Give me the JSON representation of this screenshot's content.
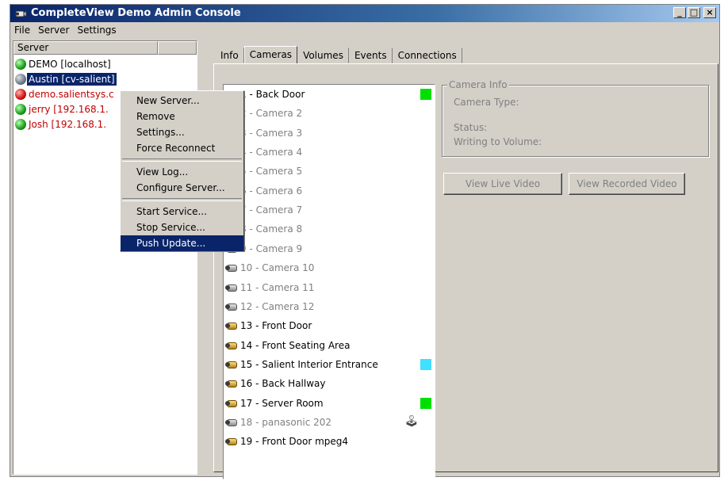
{
  "window": {
    "title": "CompleteView Demo Admin Console",
    "controls": [
      "_",
      "□",
      "×"
    ]
  },
  "menubar": [
    "File",
    "Server",
    "Settings"
  ],
  "server_pane": {
    "header": "Server",
    "servers": [
      {
        "label": "DEMO [localhost]",
        "status": "green",
        "color": "#000000"
      },
      {
        "label": "Austin [cv-salient]",
        "status": "gray",
        "color": "#000000",
        "selected": true
      },
      {
        "label": "demo.salientsys.c",
        "status": "red",
        "color": "#c00000"
      },
      {
        "label": "jerry [192.168.1.",
        "status": "green",
        "color": "#c00000"
      },
      {
        "label": "Josh [192.168.1.",
        "status": "green",
        "color": "#c00000"
      }
    ]
  },
  "context_menu": {
    "groups": [
      [
        "New Server...",
        "Remove",
        "Settings...",
        "Force Reconnect"
      ],
      [
        "View Log...",
        "Configure Server..."
      ],
      [
        "Start Service...",
        "Stop Service...",
        "Push Update..."
      ]
    ],
    "highlighted": "Push Update..."
  },
  "tabs": [
    "Info",
    "Cameras",
    "Volumes",
    "Events",
    "Connections"
  ],
  "active_tab": "Cameras",
  "cameras": [
    {
      "label": "1 - Back Door",
      "active": true,
      "status_color": "#00e000"
    },
    {
      "label": "2 - Camera 2",
      "active": false
    },
    {
      "label": "3 - Camera 3",
      "active": false
    },
    {
      "label": "4 - Camera 4",
      "active": false
    },
    {
      "label": "5 - Camera 5",
      "active": false
    },
    {
      "label": "6 - Camera 6",
      "active": false
    },
    {
      "label": "7 - Camera 7",
      "active": false
    },
    {
      "label": "8 - Camera 8",
      "active": false
    },
    {
      "label": "9 - Camera 9",
      "active": false
    },
    {
      "label": "10 - Camera 10",
      "active": false
    },
    {
      "label": "11 - Camera 11",
      "active": false
    },
    {
      "label": "12 - Camera 12",
      "active": false
    },
    {
      "label": "13 - Front Door",
      "active": true
    },
    {
      "label": "14 - Front Seating Area",
      "active": true
    },
    {
      "label": "15 - Salient Interior Entrance",
      "active": true,
      "status_color": "#40e0ff"
    },
    {
      "label": "16 - Back Hallway",
      "active": true
    },
    {
      "label": "17 - Server Room",
      "active": true,
      "status_color": "#00e000"
    },
    {
      "label": "18 - panasonic 202",
      "active": false,
      "ptz": true
    },
    {
      "label": "19 - Front Door mpeg4",
      "active": true
    }
  ],
  "camera_info": {
    "legend": "Camera Info",
    "camera_type_label": "Camera Type:",
    "status_label": "Status:",
    "writing_label": "Writing to Volume:"
  },
  "buttons": {
    "view_live": "View Live Video",
    "view_recorded": "View Recorded Video"
  }
}
